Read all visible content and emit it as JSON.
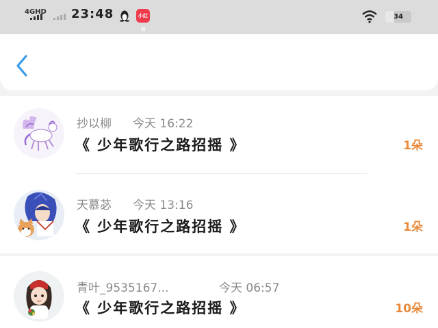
{
  "status_bar": {
    "network": "4GHD",
    "time": "23:48",
    "app_badge_text": "小红书",
    "battery_level": "34",
    "battery_percent": 34
  },
  "nav": {
    "back_icon": "chevron-left-icon",
    "accent": "#3a9be6"
  },
  "items": [
    {
      "username": "抄以柳",
      "time": "今天 16:22",
      "title": "《 少年歌行之路招摇 》",
      "count": "1朵",
      "avatar_icon": "pegasus-avatar"
    },
    {
      "username": "天慕苾",
      "time": "今天 13:16",
      "title": "《 少年歌行之路招摇 》",
      "count": "1朵",
      "avatar_icon": "anime-character-avatar"
    },
    {
      "username": "青叶_9535167...",
      "time": "今天 06:57",
      "title": "《 少年歌行之路招摇 》",
      "count": "10朵",
      "avatar_icon": "girl-character-avatar"
    }
  ],
  "colors": {
    "count": "#e88a3c",
    "back": "#3a9be6",
    "status_bg": "#dcdcdc"
  }
}
